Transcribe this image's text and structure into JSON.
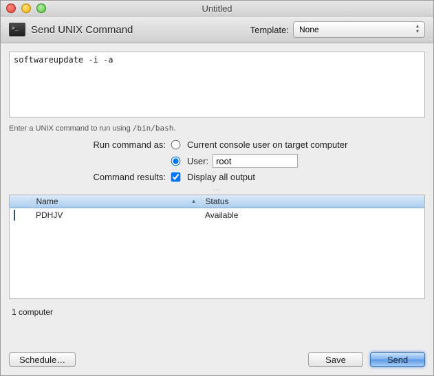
{
  "window": {
    "title": "Untitled"
  },
  "header": {
    "title": "Send UNIX Command",
    "template_label": "Template:",
    "template_value": "None"
  },
  "command": {
    "value": "softwareupdate -i -a",
    "hint_prefix": "Enter a UNIX command to run using ",
    "hint_path": "/bin/bash",
    "hint_suffix": "."
  },
  "options": {
    "run_as_label": "Run command as:",
    "current_user_label": "Current console user on target computer",
    "user_label": "User:",
    "user_value": "root",
    "run_as_selected": "user",
    "results_label": "Command results:",
    "display_all_label": "Display all output",
    "display_all_checked": true
  },
  "table": {
    "columns": {
      "name": "Name",
      "status": "Status"
    },
    "rows": [
      {
        "name": "PDHJV",
        "status": "Available"
      }
    ]
  },
  "count_label": "1 computer",
  "footer": {
    "schedule": "Schedule…",
    "save": "Save",
    "send": "Send"
  }
}
